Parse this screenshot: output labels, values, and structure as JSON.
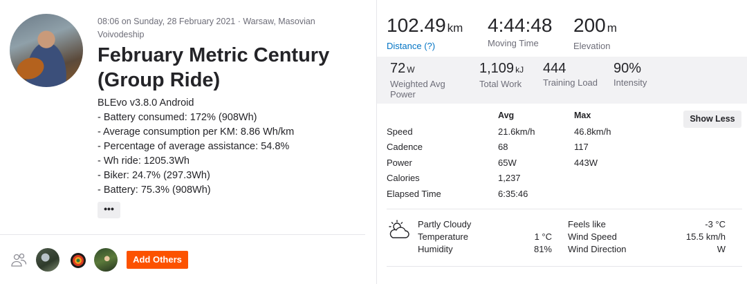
{
  "activity": {
    "meta": "08:06 on Sunday, 28 February 2021 · Warsaw, Masovian Voivodeship",
    "title": "February Metric Century (Group Ride)",
    "description": [
      "BLEvo v3.8.0 Android",
      "- Battery consumed: 172% (908Wh)",
      "- Average consumption per KM: 8.86 Wh/km",
      "- Percentage of average assistance: 54.8%",
      "- Wh ride: 1205.3Wh",
      "- Biker: 24.7% (297.3Wh)",
      "- Battery: 75.3% (908Wh)"
    ],
    "more_label": "•••",
    "add_others_label": "Add Others"
  },
  "primary_stats": [
    {
      "value": "102.49",
      "unit": "km",
      "label": "Distance (?)"
    },
    {
      "value": "4:44:48",
      "unit": "",
      "label": "Moving Time"
    },
    {
      "value": "200",
      "unit": "m",
      "label": "Elevation"
    }
  ],
  "secondary_stats": [
    {
      "value": "72",
      "unit": "W",
      "label": "Weighted Avg Power"
    },
    {
      "value": "1,109",
      "unit": "kJ",
      "label": "Total Work"
    },
    {
      "value": "444",
      "unit": "",
      "label": "Training Load"
    },
    {
      "value": "90%",
      "unit": "",
      "label": "Intensity"
    }
  ],
  "detail_table": {
    "headers": {
      "avg": "Avg",
      "max": "Max"
    },
    "rows": [
      {
        "label": "Speed",
        "avg": "21.6km/h",
        "max": "46.8km/h"
      },
      {
        "label": "Cadence",
        "avg": "68",
        "max": "117"
      },
      {
        "label": "Power",
        "avg": "65W",
        "max": "443W"
      },
      {
        "label": "Calories",
        "avg": "1,237",
        "max": ""
      },
      {
        "label": "Elapsed Time",
        "avg": "6:35:46",
        "max": ""
      }
    ],
    "show_less_label": "Show Less"
  },
  "weather": {
    "condition": "Partly Cloudy",
    "temperature_label": "Temperature",
    "temperature": "1 °C",
    "humidity_label": "Humidity",
    "humidity": "81%",
    "feels_like_label": "Feels like",
    "feels_like": "-3 °C",
    "wind_speed_label": "Wind Speed",
    "wind_speed": "15.5 km/h",
    "wind_direction_label": "Wind Direction",
    "wind_direction": "W"
  },
  "colors": {
    "accent": "#fc5200",
    "link": "#0073c4"
  }
}
